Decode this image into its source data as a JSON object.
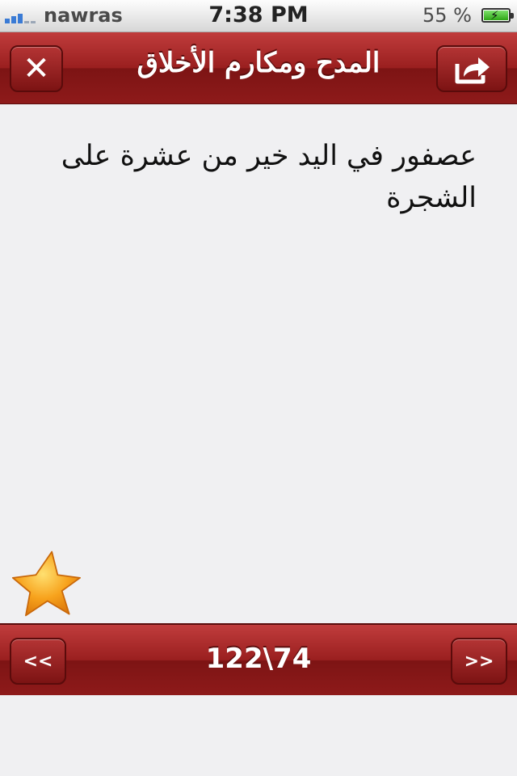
{
  "status_bar": {
    "carrier": "nawras",
    "time": "7:38 PM",
    "battery_percent": "55 %",
    "signal_bars_active": 3,
    "signal_bars_total": 5
  },
  "navbar": {
    "title": "المدح ومكارم الأخلاق",
    "close_icon": "close-icon",
    "share_icon": "share-icon"
  },
  "content": {
    "quote": "عصفور في اليد خير من عشرة على الشجرة",
    "favorite_icon": "star-icon"
  },
  "pager": {
    "prev_label": "<<",
    "next_label": ">>",
    "counter": "122\\74"
  },
  "colors": {
    "bar_red": "#9a1f1f",
    "background": "#f0f0f2"
  }
}
